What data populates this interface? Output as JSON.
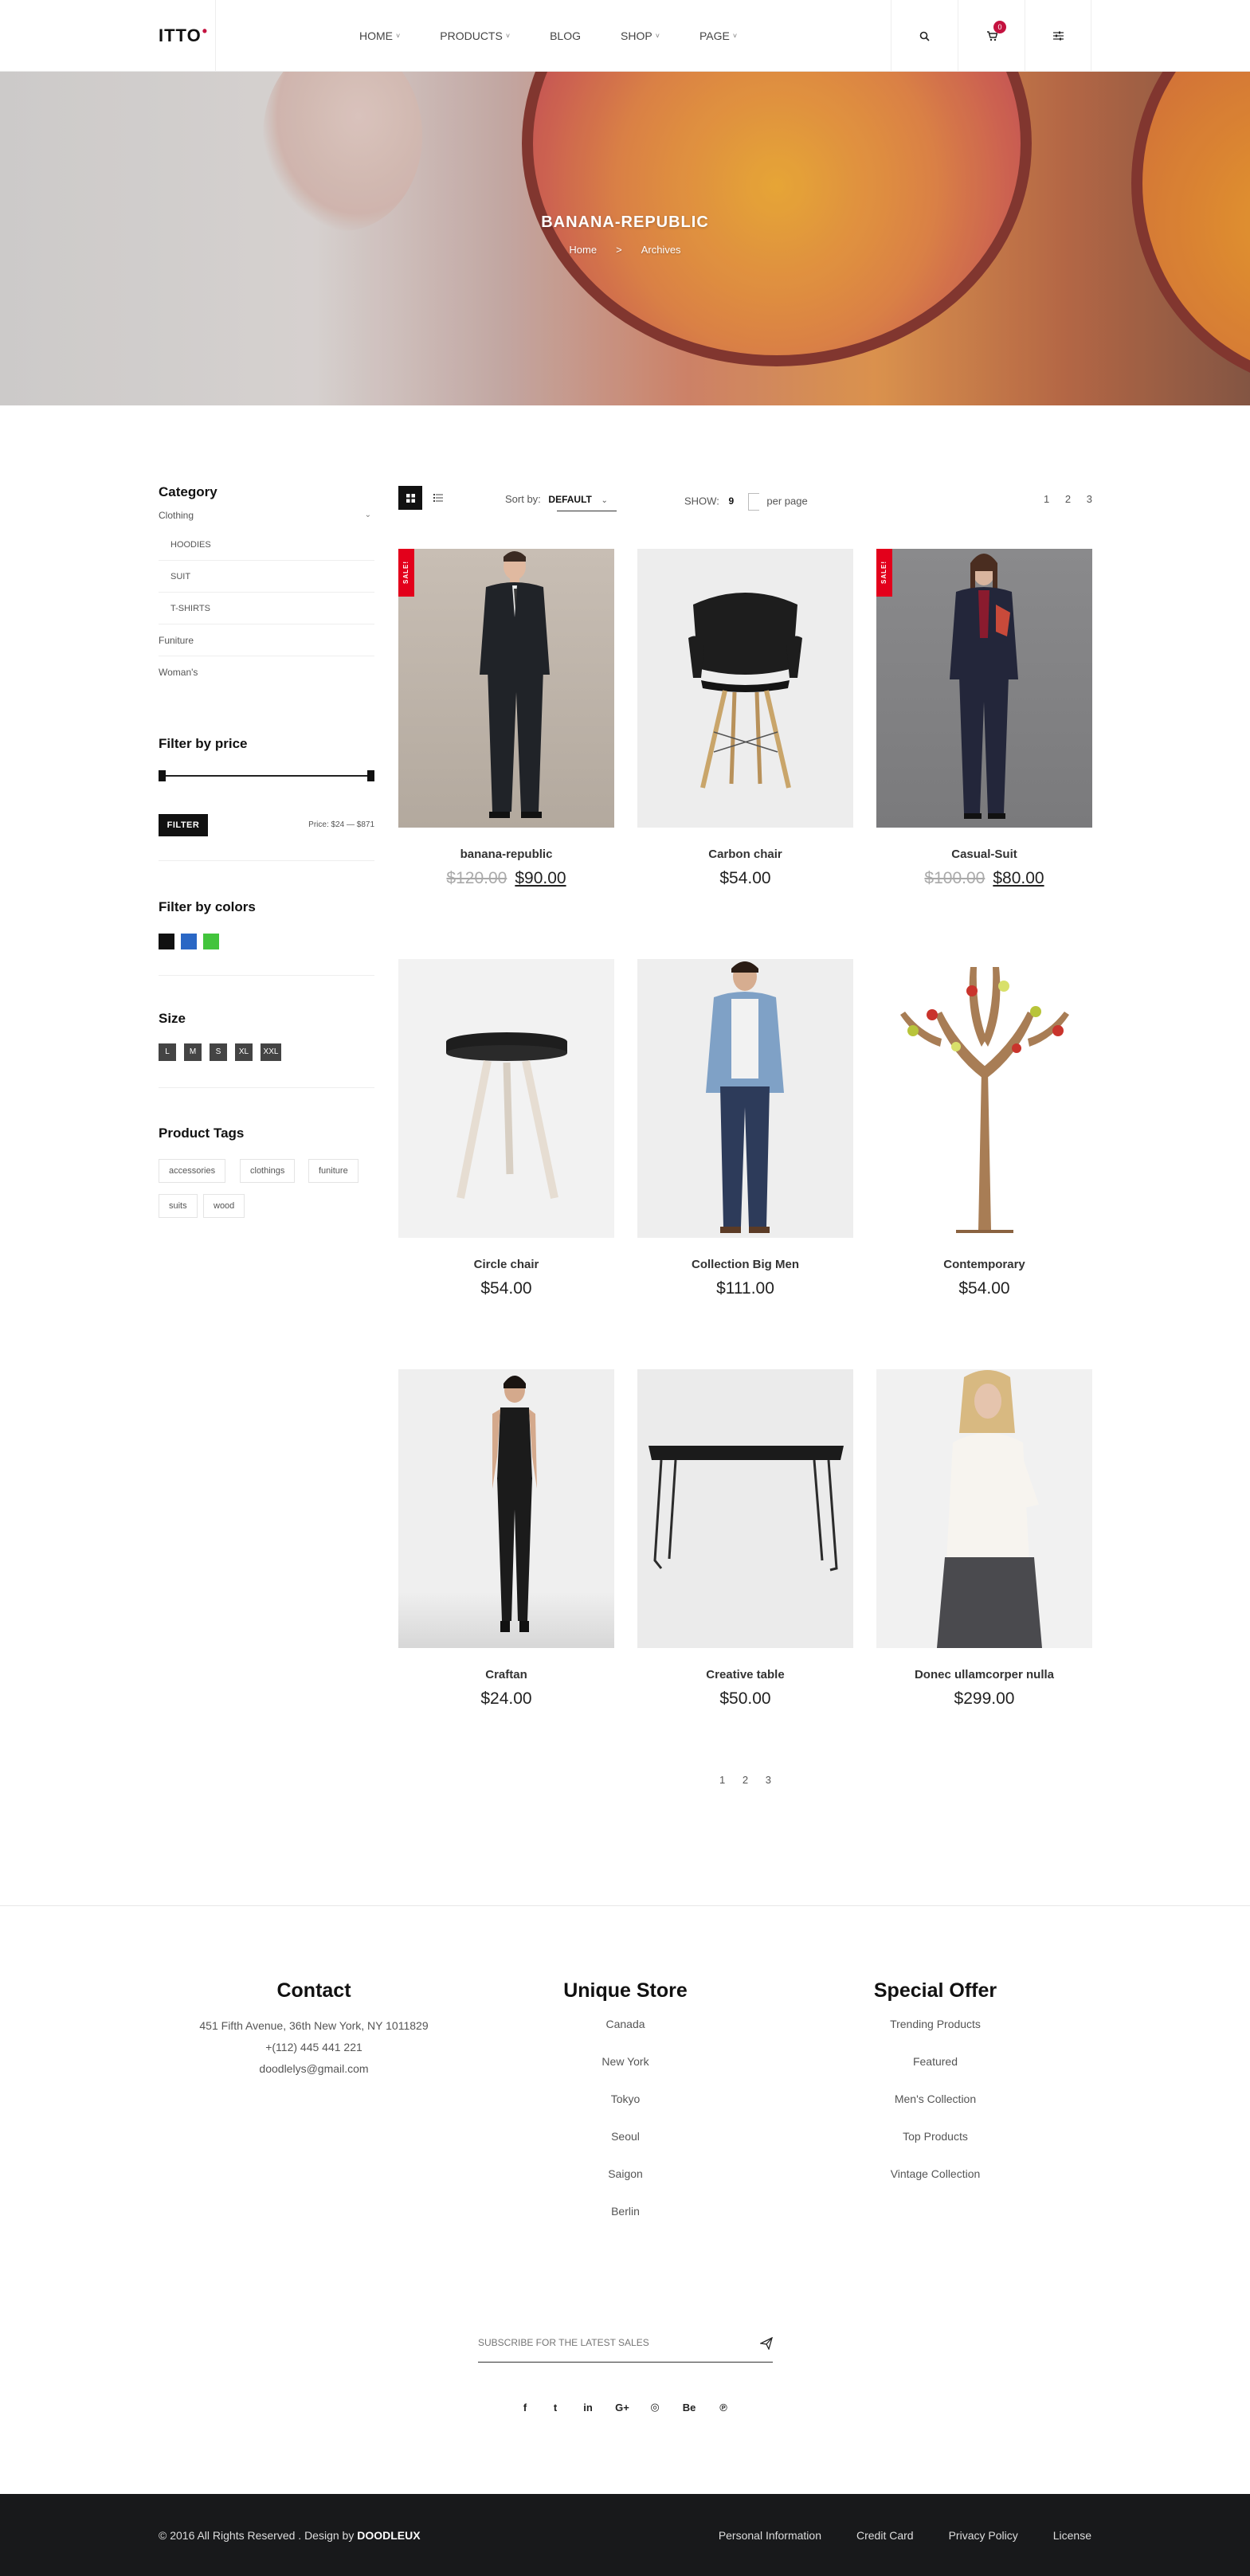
{
  "header": {
    "logo": "ITTO",
    "logo_dot": "•",
    "nav": [
      {
        "label": "HOME",
        "caret": "˅"
      },
      {
        "label": "PRODUCTS",
        "caret": "˅"
      },
      {
        "label": "BLOG",
        "caret": ""
      },
      {
        "label": "SHOP",
        "caret": "˅"
      },
      {
        "label": "PAGE",
        "caret": "˅"
      }
    ],
    "cart_count": "0"
  },
  "hero": {
    "title": "BANANA-REPUBLIC",
    "breadcrumb": [
      "Home",
      ">",
      "Archives"
    ]
  },
  "sidebar": {
    "category_title": "Category",
    "categories": {
      "clothing": "Clothing",
      "clothing_subs": [
        "HOODIES",
        "SUIT",
        "T-SHIRTS"
      ],
      "furniture": "Funiture",
      "womens": "Woman's"
    },
    "price_title": "Filter by price",
    "filter_button": "FILTER",
    "price_range": "Price: $24 — $871",
    "colors_title": "Filter by colors",
    "colors": [
      "#111111",
      "#2a67c5",
      "#42c43c"
    ],
    "size_title": "Size",
    "sizes": [
      "L",
      "M",
      "S",
      "XL",
      "XXL"
    ],
    "tags_title": "Product Tags",
    "tags": [
      "accessories",
      "clothings",
      "funiture",
      "suits",
      "wood"
    ]
  },
  "toolbar": {
    "sort_label": "Sort by:",
    "sort_value": "DEFAULT",
    "show_label": "SHOW:",
    "show_value": "9",
    "per_page": "per page",
    "pages": [
      "1",
      "2",
      "3"
    ]
  },
  "products": [
    {
      "name": "banana-republic",
      "old_price": "$120.00",
      "price": "$90.00",
      "sale": "SALE!"
    },
    {
      "name": "Carbon chair",
      "old_price": "",
      "price": "$54.00",
      "sale": ""
    },
    {
      "name": "Casual-Suit",
      "old_price": "$100.00",
      "price": "$80.00",
      "sale": "SALE!"
    },
    {
      "name": "Circle chair",
      "old_price": "",
      "price": "$54.00",
      "sale": ""
    },
    {
      "name": "Collection Big Men",
      "old_price": "",
      "price": "$111.00",
      "sale": ""
    },
    {
      "name": "Contemporary",
      "old_price": "",
      "price": "$54.00",
      "sale": ""
    },
    {
      "name": "Craftan",
      "old_price": "",
      "price": "$24.00",
      "sale": ""
    },
    {
      "name": "Creative table",
      "old_price": "",
      "price": "$50.00",
      "sale": ""
    },
    {
      "name": "Donec ullamcorper nulla",
      "old_price": "",
      "price": "$299.00",
      "sale": ""
    }
  ],
  "bottom_pagination": [
    "1",
    "2",
    "3"
  ],
  "footer": {
    "contact_title": "Contact",
    "contact_lines": [
      "451 Fifth Avenue, 36th New York, NY 1011829",
      "+(112) 445 441 221",
      "doodlelys@gmail.com"
    ],
    "store_title": "Unique Store",
    "stores": [
      "Canada",
      "New York",
      "Tokyo",
      "Seoul",
      "Saigon",
      "Berlin"
    ],
    "offer_title": "Special Offer",
    "offers": [
      "Trending Products",
      "Featured",
      "Men's Collection",
      "Top Products",
      "Vintage Collection"
    ],
    "subscribe_placeholder": "SUBSCRIBE FOR THE LATEST SALES",
    "social": [
      "f",
      "t",
      "in",
      "G+",
      "◎",
      "Be",
      "℗"
    ],
    "social_icons": [
      "facebook-icon",
      "twitter-icon",
      "linkedin-icon",
      "google-plus-icon",
      "dribbble-icon",
      "behance-icon",
      "pinterest-icon"
    ],
    "copyright": "© 2016 All Rights Reserved . Design by",
    "brand": "DOODLEUX",
    "links": [
      "Personal Information",
      "Credit Card",
      "Privacy Policy",
      "License"
    ]
  },
  "colors": {
    "accent": "#c4123f",
    "sale": "#e3001b",
    "footer_bg": "#18191b"
  }
}
